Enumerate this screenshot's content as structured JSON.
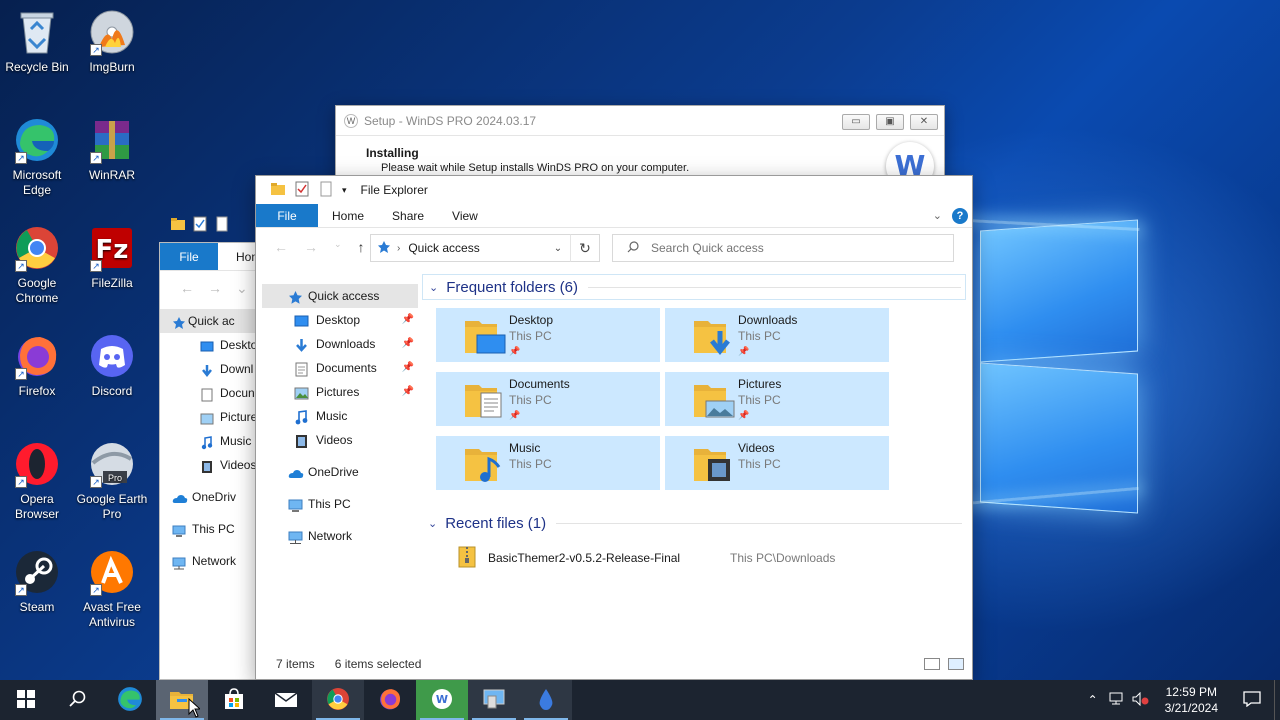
{
  "desktop": {
    "icons": [
      {
        "label": "Recycle Bin"
      },
      {
        "label": "ImgBurn"
      },
      {
        "label": "Microsoft Edge"
      },
      {
        "label": "WinRAR"
      },
      {
        "label": "Google Chrome"
      },
      {
        "label": "FileZilla"
      },
      {
        "label": "Firefox"
      },
      {
        "label": "Discord"
      },
      {
        "label": "Opera Browser"
      },
      {
        "label": "Google Earth Pro"
      },
      {
        "label": "Steam"
      },
      {
        "label": "Avast Free Antivirus"
      }
    ]
  },
  "setup": {
    "title": "Setup - WinDS PRO 2024.03.17",
    "heading": "Installing",
    "message": "Please wait while Setup installs WinDS PRO on your computer.",
    "logo_letter": "W",
    "min": "▭",
    "restore": "▣",
    "close": "✕"
  },
  "explorer_back": {
    "file_tab": "File",
    "home_tab": "Hon",
    "nav": [
      {
        "label": "Quick ac"
      },
      {
        "label": "Deskto"
      },
      {
        "label": "Downl"
      },
      {
        "label": "Docun"
      },
      {
        "label": "Picture"
      },
      {
        "label": "Music"
      },
      {
        "label": "Videos"
      },
      {
        "label": "OneDriv"
      },
      {
        "label": "This PC"
      },
      {
        "label": "Network"
      }
    ]
  },
  "explorer": {
    "title": "File Explorer",
    "tabs": {
      "file": "File",
      "home": "Home",
      "share": "Share",
      "view": "View"
    },
    "help": "?",
    "address": {
      "location": "Quick access"
    },
    "search": {
      "placeholder": "Search Quick access"
    },
    "nav": {
      "quick_access": "Quick access",
      "desktop": "Desktop",
      "downloads": "Downloads",
      "documents": "Documents",
      "pictures": "Pictures",
      "music": "Music",
      "videos": "Videos",
      "onedrive": "OneDrive",
      "this_pc": "This PC",
      "network": "Network"
    },
    "frequent": {
      "heading": "Frequent folders (6)",
      "folders": [
        {
          "name": "Desktop",
          "location": "This PC",
          "pinned": true
        },
        {
          "name": "Downloads",
          "location": "This PC",
          "pinned": true
        },
        {
          "name": "Documents",
          "location": "This PC",
          "pinned": true
        },
        {
          "name": "Pictures",
          "location": "This PC",
          "pinned": true
        },
        {
          "name": "Music",
          "location": "This PC",
          "pinned": false
        },
        {
          "name": "Videos",
          "location": "This PC",
          "pinned": false
        }
      ]
    },
    "recent": {
      "heading": "Recent files (1)",
      "files": [
        {
          "name": "BasicThemer2-v0.5.2-Release-Final",
          "location": "This PC\\Downloads"
        }
      ]
    },
    "status": {
      "items": "7 items",
      "selected": "6 items selected"
    }
  },
  "taskbar": {
    "clock_time": "12:59 PM",
    "clock_date": "3/21/2024"
  },
  "colors": {
    "accent": "#1979ca",
    "selection": "#cce8ff",
    "taskbar": "#1c2430",
    "folder": "#f5c242"
  }
}
